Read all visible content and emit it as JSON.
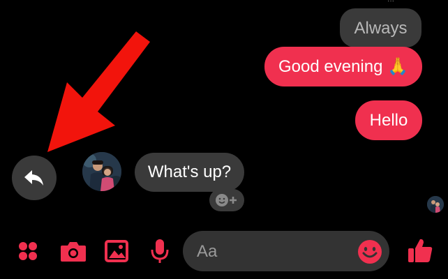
{
  "colors": {
    "accent": "#f0304f",
    "annotation_arrow": "#f2140c",
    "bubble_grey": "#3a3a3a"
  },
  "messages": [
    {
      "text": "Always",
      "direction": "outgoing",
      "style": "grey"
    },
    {
      "text": "Good evening 🙏",
      "direction": "outgoing",
      "style": "accent"
    },
    {
      "text": "Hello",
      "direction": "outgoing",
      "style": "accent"
    },
    {
      "text": "What's up?",
      "direction": "incoming",
      "style": "grey"
    }
  ],
  "reaction_button": {
    "icon": "smiley-plus-icon"
  },
  "reply_button": {
    "icon": "reply-icon"
  },
  "composer": {
    "placeholder": "Aa",
    "emoji_icon": "smiley-icon"
  },
  "toolbar": {
    "icons": [
      "apps-grid-icon",
      "camera-icon",
      "gallery-icon",
      "microphone-icon"
    ],
    "like_icon": "thumbs-up-icon"
  },
  "annotation": {
    "type": "arrow",
    "points_to": "reply-button"
  }
}
